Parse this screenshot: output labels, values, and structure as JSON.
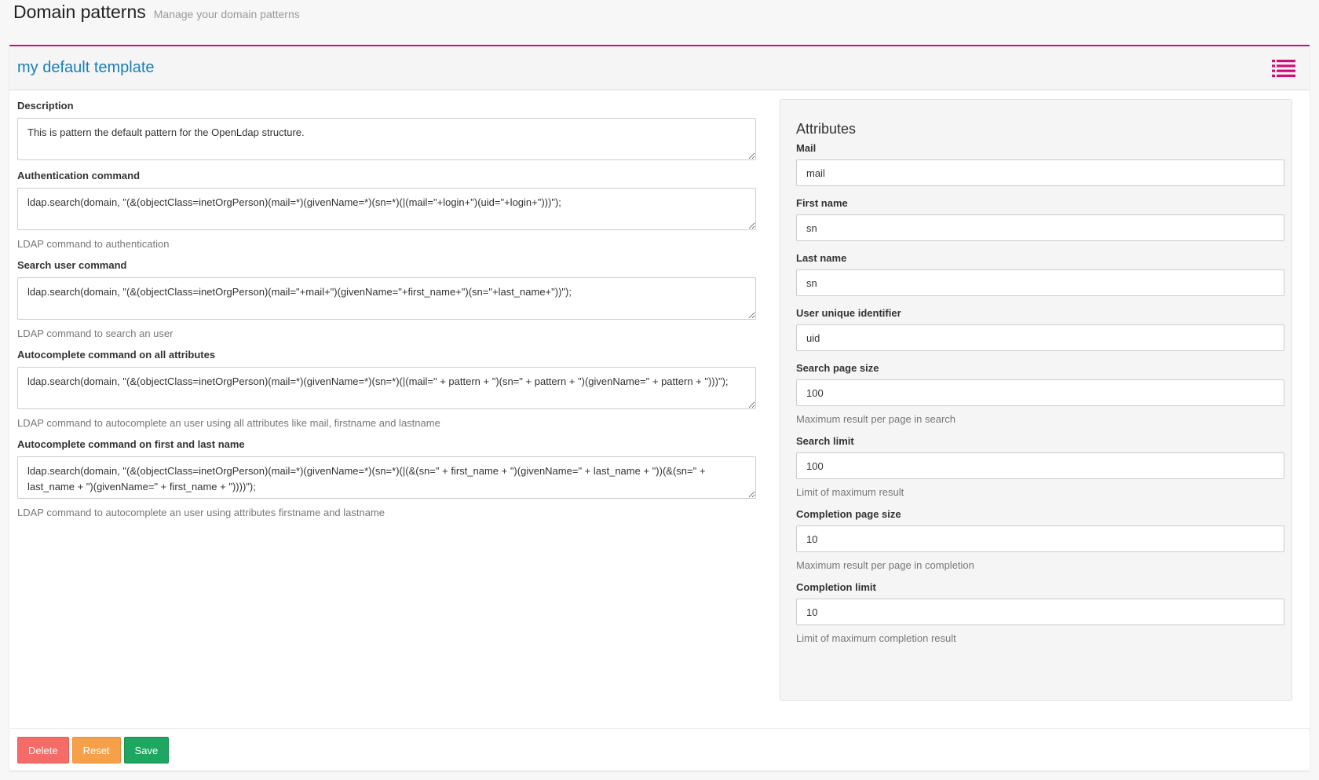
{
  "header": {
    "title": "Domain patterns",
    "subtitle": "Manage your domain patterns"
  },
  "panel": {
    "title": "my default template",
    "accent_color": "#d10d7a",
    "menu_icon": "list-icon"
  },
  "form": {
    "description": {
      "label": "Description",
      "value": "This is pattern the default pattern for the OpenLdap structure."
    },
    "auth_command": {
      "label": "Authentication command",
      "value": "ldap.search(domain, \"(&(objectClass=inetOrgPerson)(mail=*)(givenName=*)(sn=*)(|(mail=\"+login+\")(uid=\"+login+\")))\");",
      "help": "LDAP command to authentication"
    },
    "search_user_command": {
      "label": "Search user command",
      "value": "ldap.search(domain, \"(&(objectClass=inetOrgPerson)(mail=\"+mail+\")(givenName=\"+first_name+\")(sn=\"+last_name+\"))\");",
      "help": "LDAP command to search an user"
    },
    "autocomplete_all_command": {
      "label": "Autocomplete command on all attributes",
      "value": "ldap.search(domain, \"(&(objectClass=inetOrgPerson)(mail=*)(givenName=*)(sn=*)(|(mail=\" + pattern + \")(sn=\" + pattern + \")(givenName=\" + pattern + \")))\");",
      "help": "LDAP command to autocomplete an user using all attributes like mail, firstname and lastname"
    },
    "autocomplete_name_command": {
      "label": "Autocomplete command on first and last name",
      "value": "ldap.search(domain, \"(&(objectClass=inetOrgPerson)(mail=*)(givenName=*)(sn=*)(|(&(sn=\" + first_name + \")(givenName=\" + last_name + \"))(&(sn=\" + last_name + \")(givenName=\" + first_name + \"))))\");",
      "help": "LDAP command to autocomplete an user using attributes firstname and lastname"
    }
  },
  "attributes": {
    "title": "Attributes",
    "mail": {
      "label": "Mail",
      "value": "mail"
    },
    "first_name": {
      "label": "First name",
      "value": "sn"
    },
    "last_name": {
      "label": "Last name",
      "value": "sn"
    },
    "uid": {
      "label": "User unique identifier",
      "value": "uid"
    },
    "search_page_size": {
      "label": "Search page size",
      "value": "100",
      "help": "Maximum result per page in search"
    },
    "search_limit": {
      "label": "Search limit",
      "value": "100",
      "help": "Limit of maximum result"
    },
    "completion_page_size": {
      "label": "Completion page size",
      "value": "10",
      "help": "Maximum result per page in completion"
    },
    "completion_limit": {
      "label": "Completion limit",
      "value": "10",
      "help": "Limit of maximum completion result"
    }
  },
  "footer": {
    "delete_label": "Delete",
    "reset_label": "Reset",
    "save_label": "Save",
    "delete_color": "#f56b67",
    "reset_color": "#f7a04a",
    "save_color": "#1da760"
  }
}
